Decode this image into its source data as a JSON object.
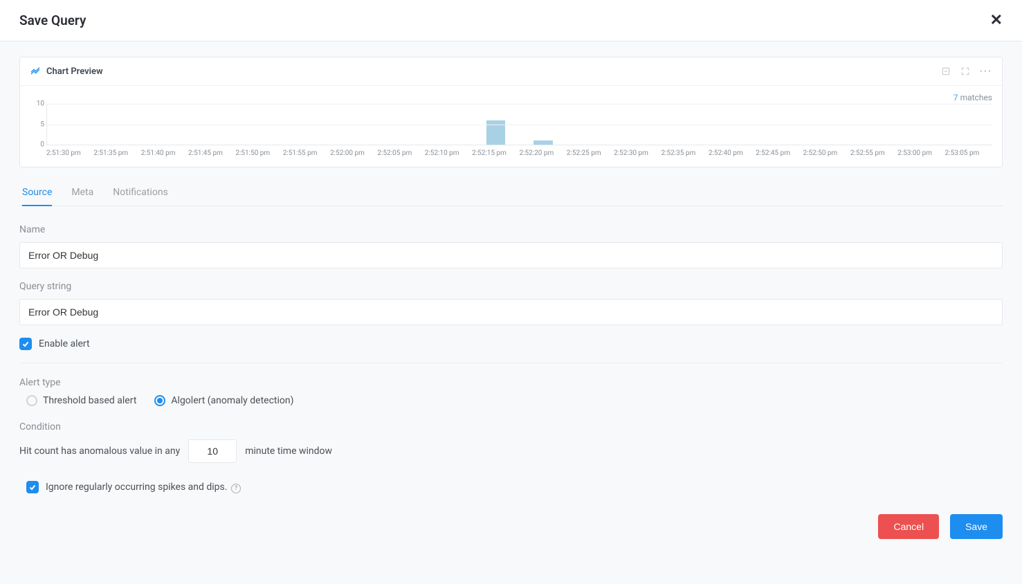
{
  "header": {
    "title": "Save Query"
  },
  "chart": {
    "title": "Chart Preview",
    "matches_count": "7",
    "matches_label": " matches"
  },
  "chart_data": {
    "type": "bar",
    "yticks": [
      10,
      5,
      0
    ],
    "ylim": [
      0,
      10
    ],
    "categories": [
      "2:51:30 pm",
      "2:51:35 pm",
      "2:51:40 pm",
      "2:51:45 pm",
      "2:51:50 pm",
      "2:51:55 pm",
      "2:52:00 pm",
      "2:52:05 pm",
      "2:52:10 pm",
      "2:52:15 pm",
      "2:52:20 pm",
      "2:52:25 pm",
      "2:52:30 pm",
      "2:52:35 pm",
      "2:52:40 pm",
      "2:52:45 pm",
      "2:52:50 pm",
      "2:52:55 pm",
      "2:53:00 pm",
      "2:53:05 pm"
    ],
    "values": [
      0,
      0,
      0,
      0,
      0,
      0,
      0,
      0,
      0,
      6,
      1,
      0,
      0,
      0,
      0,
      0,
      0,
      0,
      0,
      0
    ]
  },
  "tabs": [
    {
      "label": "Source",
      "active": true
    },
    {
      "label": "Meta",
      "active": false
    },
    {
      "label": "Notifications",
      "active": false
    }
  ],
  "form": {
    "name_label": "Name",
    "name_value": "Error OR Debug",
    "query_label": "Query string",
    "query_value": "Error OR Debug",
    "enable_alert_label": "Enable alert",
    "enable_alert_checked": true,
    "alert_type_label": "Alert type",
    "radio_threshold_label": "Threshold based alert",
    "radio_algolert_label": "Algolert (anomaly detection)",
    "selected_alert_type": "algolert",
    "condition_label": "Condition",
    "condition_prefix": "Hit count has anomalous value in any",
    "condition_value": "10",
    "condition_suffix": "minute time window",
    "ignore_spikes_label": "Ignore regularly occurring spikes and dips.",
    "ignore_spikes_checked": true
  },
  "footer": {
    "cancel_label": "Cancel",
    "save_label": "Save"
  }
}
